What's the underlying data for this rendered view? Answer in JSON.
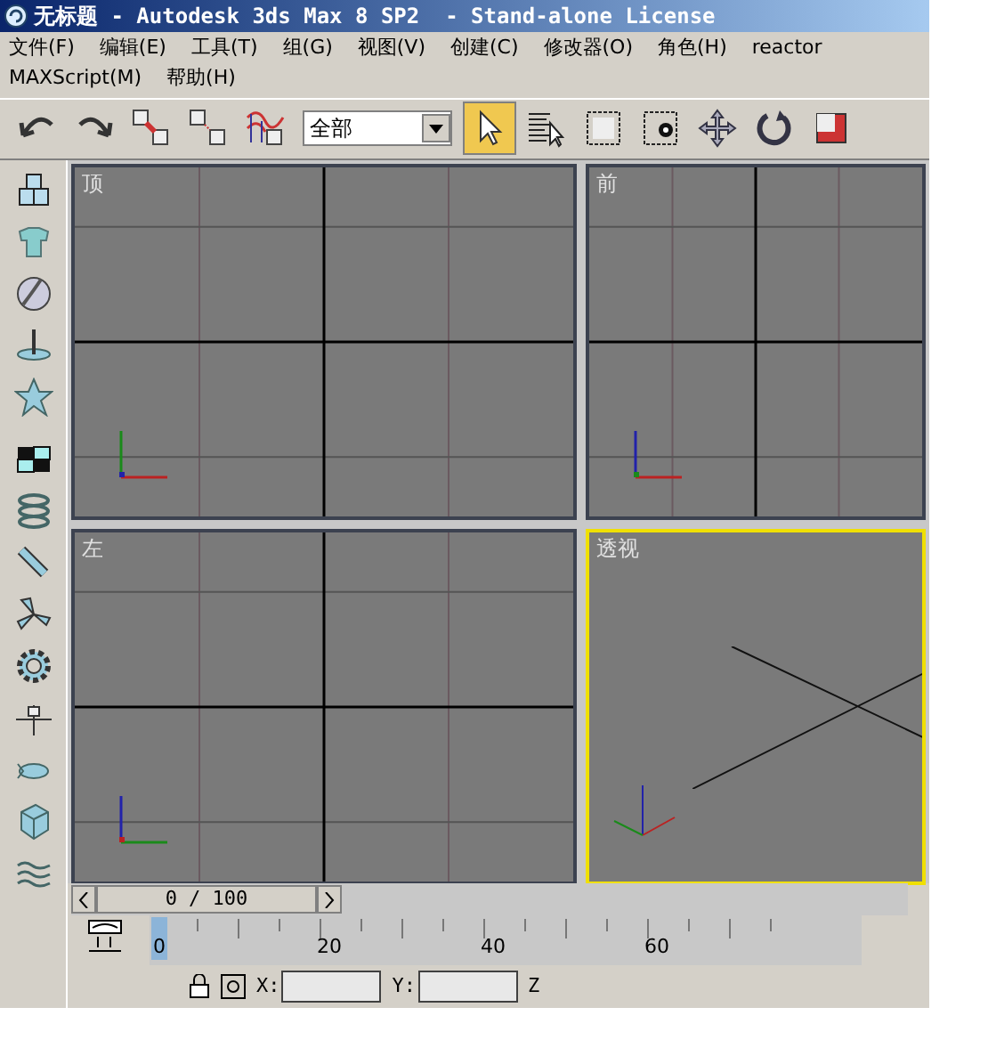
{
  "window": {
    "title": "无标题 - Autodesk 3ds Max 8 SP2  - Stand-alone License"
  },
  "menu_rows": [
    {
      "items": [
        "文件(F)",
        "编辑(E)",
        "工具(T)",
        "组(G)",
        "视图(V)",
        "创建(C)",
        "修改器(O)",
        "角色(H)",
        "reactor"
      ]
    },
    {
      "items": [
        "MAXScript(M)",
        "帮助(H)"
      ]
    }
  ],
  "toolbar": {
    "tools": [
      {
        "kind": "undo",
        "selected": false
      },
      {
        "kind": "redo",
        "selected": false
      },
      {
        "kind": "link",
        "selected": false
      },
      {
        "kind": "unlink",
        "selected": false
      },
      {
        "kind": "bind",
        "selected": false
      },
      {
        "kind": "filter",
        "value": "全部"
      },
      {
        "kind": "select",
        "selected": true
      },
      {
        "kind": "select-by-name",
        "selected": false
      },
      {
        "kind": "region",
        "selected": false
      },
      {
        "kind": "crossing",
        "selected": false
      },
      {
        "kind": "move",
        "selected": false
      },
      {
        "kind": "rotate",
        "selected": false
      },
      {
        "kind": "scale",
        "selected": false
      }
    ]
  },
  "viewports": [
    {
      "label": "顶",
      "kind": "top",
      "selected": false
    },
    {
      "label": "前",
      "kind": "front",
      "selected": false
    },
    {
      "label": "左",
      "kind": "left",
      "selected": false
    },
    {
      "label": "透视",
      "kind": "perspective",
      "selected": true
    }
  ],
  "time_slider": {
    "reading": "0 / 100",
    "level": 0
  },
  "track_bar": {
    "labels": [
      {
        "text": "0",
        "selected": true
      },
      {
        "text": "20",
        "selected": false
      },
      {
        "text": "40",
        "selected": false
      },
      {
        "text": "60",
        "selected": false
      }
    ]
  },
  "status_bar": {
    "labels": [
      "X:",
      "Y:",
      "Z"
    ]
  }
}
